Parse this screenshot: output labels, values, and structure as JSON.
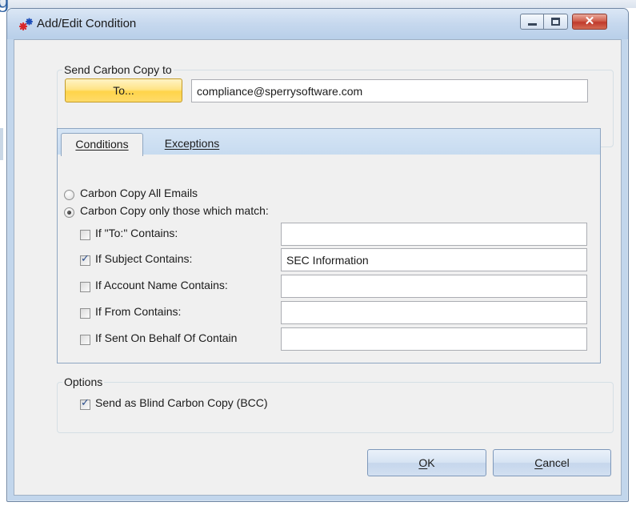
{
  "window": {
    "title": "Add/Edit Condition"
  },
  "window_controls": {
    "close_glyph": "✕"
  },
  "send_cc": {
    "legend": "Send Carbon Copy to",
    "to_button": "To...",
    "to_value": "compliance@sperrysoftware.com"
  },
  "tabs": {
    "conditions": {
      "label": "Conditions",
      "active": true
    },
    "exceptions": {
      "label": "Exceptions",
      "active": false
    }
  },
  "conditions": {
    "radio_all": {
      "label": "Carbon Copy All Emails",
      "checked": false
    },
    "radio_match": {
      "label": "Carbon Copy only those which match:",
      "checked": true
    },
    "rows": [
      {
        "label": "If \"To:\" Contains:",
        "checked": false,
        "value": ""
      },
      {
        "label": "If Subject Contains:",
        "checked": true,
        "value": "SEC Information"
      },
      {
        "label": "If Account Name Contains:",
        "checked": false,
        "value": ""
      },
      {
        "label": "If From Contains:",
        "checked": false,
        "value": ""
      },
      {
        "label": "If Sent On Behalf Of Contain",
        "checked": false,
        "value": ""
      }
    ]
  },
  "options": {
    "legend": "Options",
    "bcc": {
      "label": "Send as Blind Carbon Copy (BCC)",
      "checked": true
    }
  },
  "buttons": {
    "ok_mnemonic": "O",
    "ok_rest": "K",
    "cancel_mnemonic": "C",
    "cancel_rest": "ancel"
  },
  "colors": {
    "titlebar": "#c6d8ee",
    "to_button": "#ffd44a",
    "close_button": "#c0392b",
    "tab_strip": "#c7dbf0"
  },
  "icons": {
    "app": "sperry-star-icon",
    "minimize": "minimize-icon",
    "maximize": "maximize-icon",
    "close": "close-icon"
  }
}
